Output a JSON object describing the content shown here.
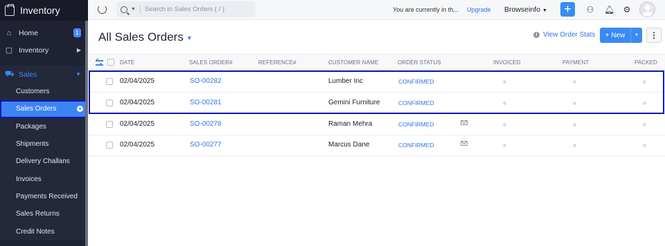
{
  "app": {
    "title": "Inventory"
  },
  "sidebar": {
    "items": [
      {
        "label": "Home",
        "icon": "home-icon",
        "badge": "1"
      },
      {
        "label": "Inventory",
        "icon": "box-icon"
      },
      {
        "label": "Sales",
        "icon": "cart-icon"
      }
    ],
    "sales_items": [
      "Customers",
      "Sales Orders",
      "Packages",
      "Shipments",
      "Delivery Challans",
      "Invoices",
      "Payments Received",
      "Sales Returns",
      "Credit Notes"
    ],
    "active": "Sales Orders"
  },
  "topbar": {
    "search_placeholder": "Search in Sales Orders ( / )",
    "trial_text": "You are currently in th...",
    "upgrade": "Upgrade",
    "org": "Browseinfo"
  },
  "main": {
    "title": "All Sales Orders",
    "view_stats": "View Order Stats",
    "new_label": "+ New"
  },
  "table": {
    "columns": [
      "DATE",
      "SALES ORDER#",
      "REFERENCE#",
      "CUSTOMER NAME",
      "ORDER STATUS",
      "INVOICED",
      "PAYMENT",
      "PACKED"
    ],
    "rows": [
      {
        "date": "02/04/2025",
        "order": "SO-00282",
        "reference": "",
        "customer": "Lumber Inc",
        "status": "CONFIRMED",
        "mail": false
      },
      {
        "date": "02/04/2025",
        "order": "SO-00281",
        "reference": "",
        "customer": "Gemini Furniture",
        "status": "CONFIRMED",
        "mail": false
      },
      {
        "date": "02/04/2025",
        "order": "SO-00278",
        "reference": "",
        "customer": "Raman Mehra",
        "status": "CONFIRMED",
        "mail": true
      },
      {
        "date": "02/04/2025",
        "order": "SO-00277",
        "reference": "",
        "customer": "Marcus Dane",
        "status": "CONFIRMED",
        "mail": true
      }
    ]
  },
  "colors": {
    "accent": "#3d84f2",
    "sidebar": "#1f2233",
    "highlight": "#0c17b5"
  }
}
